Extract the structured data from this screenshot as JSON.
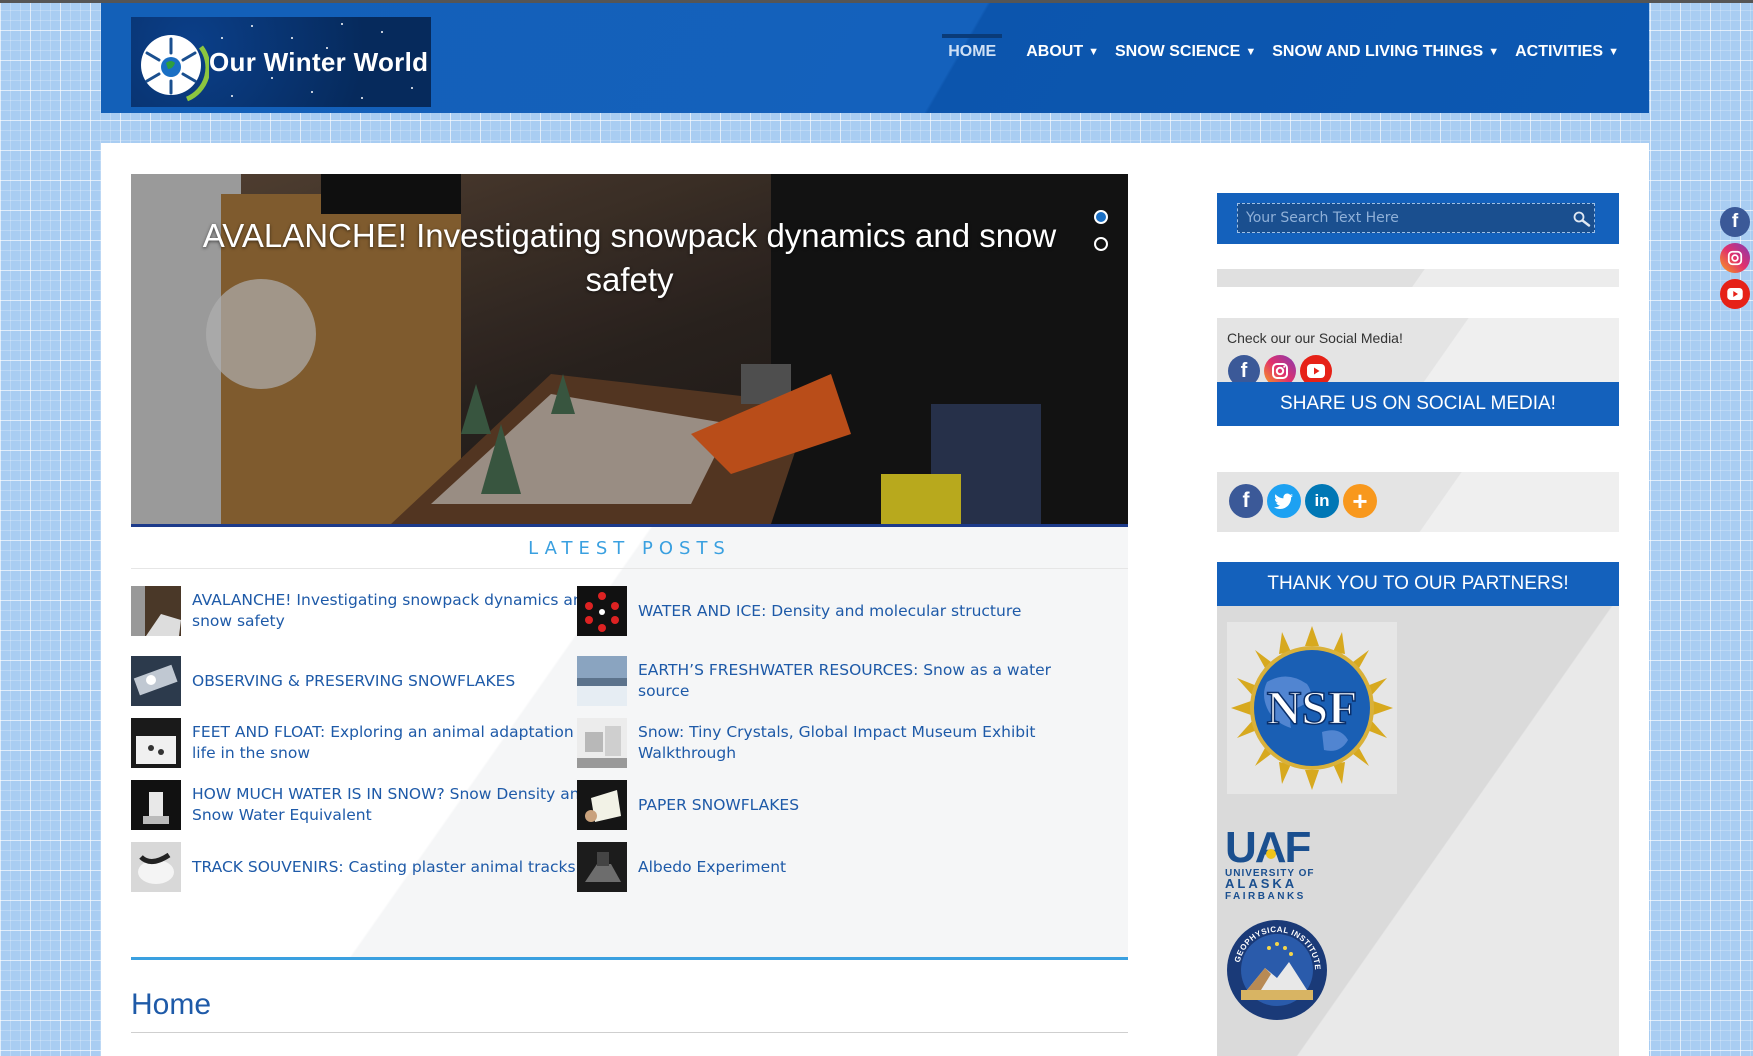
{
  "site": {
    "logo_text": "Our Winter World"
  },
  "nav": {
    "items": [
      {
        "label": "HOME",
        "has_dropdown": false,
        "active": true
      },
      {
        "label": "ABOUT",
        "has_dropdown": true
      },
      {
        "label": "SNOW SCIENCE",
        "has_dropdown": true
      },
      {
        "label": "SNOW AND LIVING THINGS",
        "has_dropdown": true
      },
      {
        "label": "ACTIVITIES",
        "has_dropdown": true
      }
    ]
  },
  "slider": {
    "title": "AVALANCHE! Investigating snowpack dynamics and snow safety",
    "slide_count": 2,
    "active_slide": 1
  },
  "latest_posts": {
    "heading": "LATEST POSTS",
    "left": [
      "AVALANCHE! Investigating snowpack dynamics and snow safety",
      "OBSERVING & PRESERVING SNOWFLAKES",
      "FEET AND FLOAT: Exploring an animal adaptation for life in the snow",
      "HOW MUCH WATER IS IN SNOW? Snow Density and Snow Water Equivalent",
      "TRACK SOUVENIRS: Casting plaster animal tracks"
    ],
    "right": [
      "WATER AND ICE: Density and molecular structure",
      "EARTH’S FRESHWATER RESOURCES: Snow as a water source",
      "Snow: Tiny Crystals, Global Impact Museum Exhibit Walkthrough",
      "PAPER SNOWFLAKES",
      "Albedo Experiment"
    ]
  },
  "page": {
    "title": "Home"
  },
  "sidebar": {
    "search_placeholder": "Your Search Text Here",
    "social_text": "Check our our Social Media!",
    "share_heading": "SHARE US ON SOCIAL MEDIA!",
    "partners_heading": "THANK YOU TO OUR PARTNERS!",
    "partners": {
      "nsf": "NSF",
      "uaf_main": "UAF",
      "uaf_line1": "UNIVERSITY OF",
      "uaf_line2": "ALASKA",
      "uaf_line3": "FAIRBANKS",
      "gi_text": "GEOPHYSICAL INSTITUTE"
    }
  },
  "colors": {
    "header_blue": "#1461bc",
    "link_blue": "#1e5aa8",
    "accent_light_blue": "#3aa0e0",
    "facebook": "#3b5998",
    "twitter": "#1da1f2",
    "linkedin": "#0077b5",
    "youtube": "#e62117",
    "addthis": "#f8981d"
  },
  "icons": [
    "facebook-icon",
    "instagram-icon",
    "youtube-icon",
    "twitter-icon",
    "linkedin-icon",
    "plus-icon",
    "search-icon"
  ]
}
